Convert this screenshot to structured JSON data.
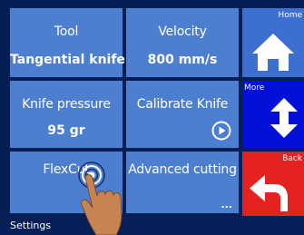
{
  "tiles": {
    "tool": {
      "title": "Tool",
      "value": "Tangential knife"
    },
    "velocity": {
      "title": "Velocity",
      "value": "800 mm/s"
    },
    "knife_pressure": {
      "title": "Knife pressure",
      "value": "95 gr"
    },
    "calibrate_knife": {
      "title": "Calibrate Knife",
      "icon": "play-circle-icon"
    },
    "flexcut": {
      "title": "FlexCut",
      "more": "..."
    },
    "advanced_cutting": {
      "title": "Advanced cutting",
      "more": "..."
    }
  },
  "side_buttons": {
    "home": {
      "label": "Home",
      "icon": "home-icon"
    },
    "more": {
      "label": "More",
      "icon": "up-down-arrow-icon"
    },
    "back": {
      "label": "Back",
      "icon": "back-arrow-icon"
    }
  },
  "statusbar": {
    "label": "Settings"
  },
  "colors": {
    "tile": "#4d7fd0",
    "home": "#3d6fd0",
    "more": "#0010d8",
    "back": "#e52222",
    "background": "#051f55"
  }
}
